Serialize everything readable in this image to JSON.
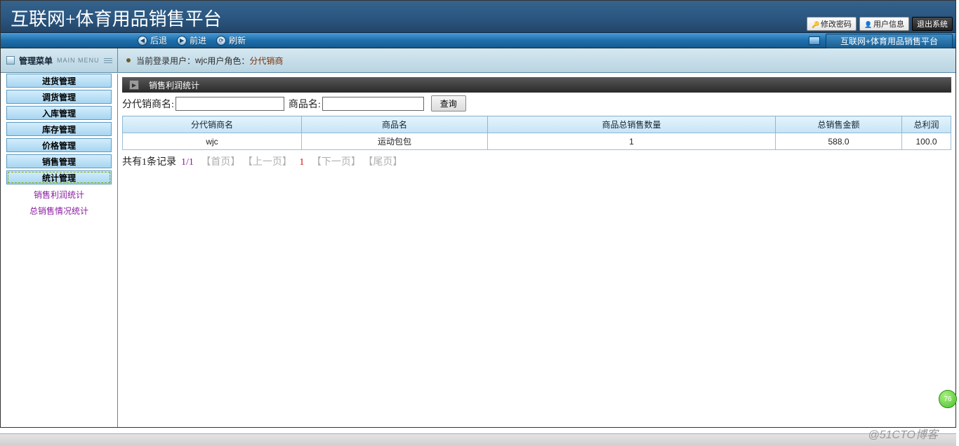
{
  "header": {
    "title": "互联网+体育用品销售平台",
    "btn_pwd": "修改密码",
    "btn_user": "用户信息",
    "btn_exit": "退出系统"
  },
  "nav": {
    "back": "后退",
    "forward": "前进",
    "refresh": "刷新",
    "tab": "互联网+体育用品销售平台"
  },
  "band": {
    "menu": "管理菜单",
    "menu_en": "MAIN MENU",
    "login_prefix": "当前登录用户：",
    "login_user": "wjc",
    "role_prefix": " 用户角色：",
    "role_value": "分代销商"
  },
  "sidebar": {
    "items": [
      "进货管理",
      "调货管理",
      "入库管理",
      "库存管理",
      "价格管理",
      "销售管理",
      "统计管理"
    ],
    "subs": [
      "销售利润统计",
      "总销售情况统计"
    ]
  },
  "panel": {
    "title": "销售利润统计"
  },
  "search": {
    "label_dealer": "分代销商名:",
    "label_product": "商品名:",
    "value_dealer": "",
    "value_product": "",
    "btn_query": "查询"
  },
  "table": {
    "headers": [
      "分代销商名",
      "商品名",
      "商品总销售数量",
      "总销售金额",
      "总利润"
    ],
    "rows": [
      [
        "wjc",
        "运动包包",
        "1",
        "588.0",
        "100.0"
      ]
    ],
    "col_widths": [
      "255px",
      "265px",
      "410px",
      "180px",
      "auto"
    ]
  },
  "pager": {
    "total_text": "共有1条记录",
    "page_pos": "1/1",
    "first": "【首页】",
    "prev": "【上一页】",
    "current": "1",
    "next": "【下一页】",
    "last": "【尾页】"
  },
  "watermark": "@51CTO博客",
  "badge": "76"
}
